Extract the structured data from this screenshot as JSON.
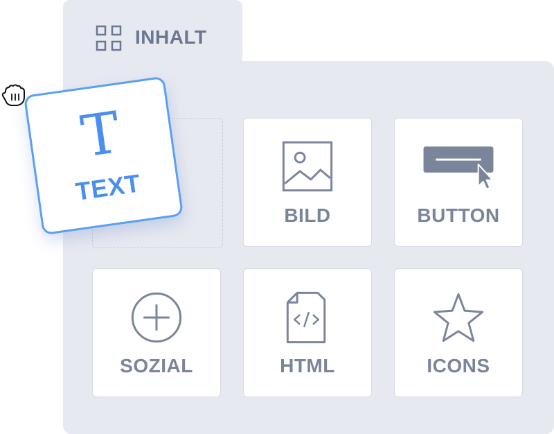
{
  "tab": {
    "icon": "grid-icon",
    "label": "INHALT"
  },
  "drag_item": {
    "glyph": "T",
    "label": "TEXT",
    "icon": "text-icon",
    "accent": "#4a8ff0"
  },
  "tiles": [
    {
      "label": "BILD",
      "icon": "image-icon"
    },
    {
      "label": "BUTTON",
      "icon": "button-cursor-icon"
    },
    {
      "label": "SOZIAL",
      "icon": "plus-circle-icon"
    },
    {
      "label": "HTML",
      "icon": "code-file-icon"
    },
    {
      "label": "ICONS",
      "icon": "star-icon"
    }
  ],
  "cursor": {
    "icon": "grab-hand-icon"
  },
  "colors": {
    "panel": "#e7e9f1",
    "icon": "#7a849a",
    "accent": "#5b9ff2"
  }
}
